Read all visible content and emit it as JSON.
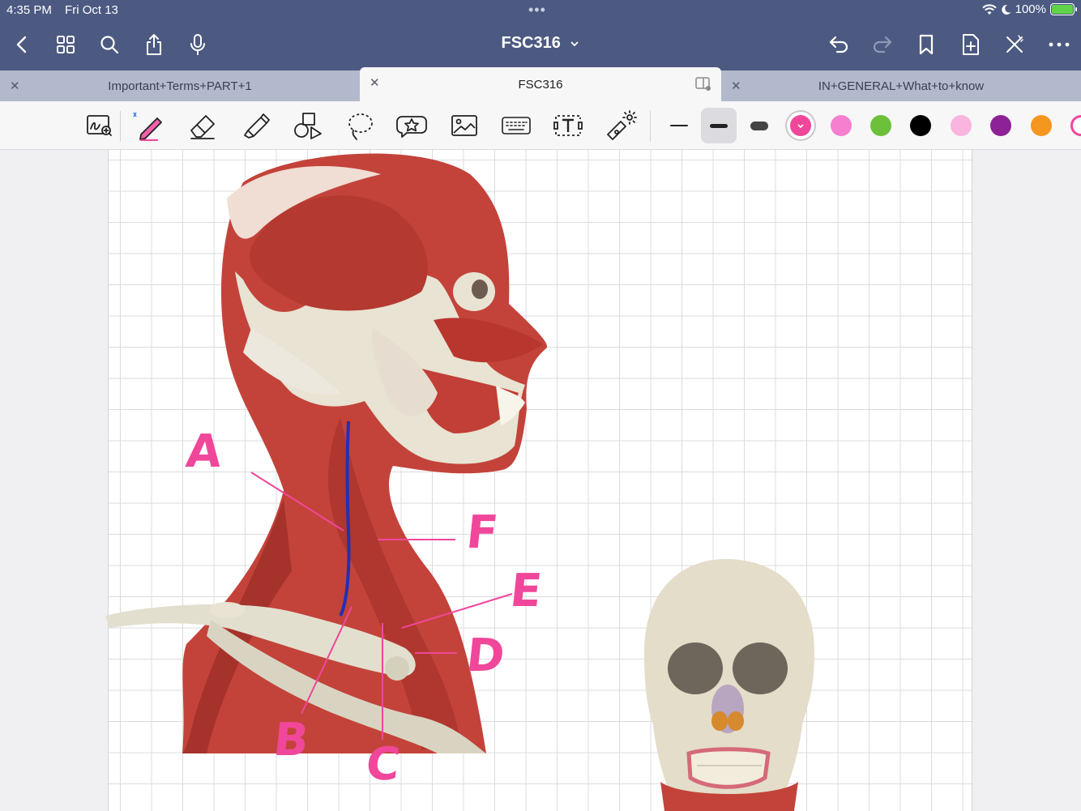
{
  "status": {
    "time": "4:35 PM",
    "date": "Fri Oct 13",
    "battery": "100%"
  },
  "nav": {
    "title": "FSC316",
    "icons": [
      "back-icon",
      "grid-icon",
      "search-icon",
      "share-icon",
      "microphone-icon",
      "undo-icon",
      "redo-icon",
      "bookmark-icon",
      "add-page-icon",
      "close-x-icon",
      "more-icon"
    ]
  },
  "tabs": [
    {
      "label": "Important+Terms+PART+1",
      "active": false
    },
    {
      "label": "FSC316",
      "active": true
    },
    {
      "label": "IN+GENERAL+What+to+know",
      "active": false
    }
  ],
  "toolbar": {
    "tools": [
      "zoom-window-tool",
      "pen-tool",
      "eraser-tool",
      "highlighter-tool",
      "shapes-tool",
      "lasso-tool",
      "elements-tool",
      "image-tool",
      "keyboard-tool",
      "text-tool",
      "laser-pointer-tool"
    ],
    "selected_tool": "pen-tool",
    "stroke_widths": [
      "thin",
      "medium",
      "thick"
    ],
    "selected_stroke": "medium",
    "colors": [
      "#f0479a",
      "#f77fcf",
      "#6cc03a",
      "#000000",
      "#f9b4e0",
      "#8c2296",
      "#f5961f"
    ],
    "selected_color": "#f0479a"
  },
  "canvas": {
    "labels": [
      "A",
      "F",
      "E",
      "D",
      "B",
      "C"
    ],
    "ink_color": "#f0479a",
    "vessel_color": "#2230b5"
  }
}
